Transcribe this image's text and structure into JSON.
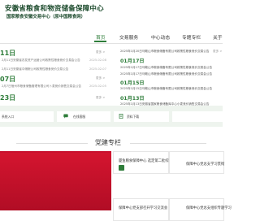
{
  "header": {
    "org_title": "安徽省粮食和物资储备保障中心",
    "org_subtitle": "国家粮食安徽交易中心（原中国粮食网）"
  },
  "nav": [
    "首页",
    "交易服务",
    "中心动态",
    "专题专栏",
    "关于"
  ],
  "left_news": [
    {
      "date": "11日",
      "more": "更多 >"
    },
    {
      "title": "2月11日安徽省农发资产运营公司政策性粮食竞价交易会公告",
      "date": "2025-02-08"
    },
    {
      "title": "2月11日安徽省中储粮公司政策性粮食竞价交易公告",
      "date": "2025-02-07"
    },
    {
      "date": "07日",
      "more": "更多 >"
    },
    {
      "title": "2月7日宿州市粮食储备管理有限公司卜麦竞价销售交易会公告",
      "date": "2025-02-05"
    },
    {
      "date": "23日",
      "more": "更多 >"
    }
  ],
  "right_news": [
    {
      "type": "item",
      "text": "2025年1月20日马鞍山市粮食储备有限公司政策性粮食竞价交易公告",
      "more": "更多 >"
    },
    {
      "type": "date",
      "text": "01月17日"
    },
    {
      "type": "item",
      "text": "2025年1月17日马鞍山市粮食储备有限公司政策性粮食竞价交易会公告"
    },
    {
      "type": "item",
      "text": "2025年1月17日马鞍山市粮食储备有限公司政策性粮食竞价交易会公告"
    },
    {
      "type": "date",
      "text": "01月15日"
    },
    {
      "type": "item",
      "text": "2025年1月15日马鞍山市粮食储备有限公司政策性粮食竞价交易会公告"
    },
    {
      "type": "date",
      "text": "01月13日"
    },
    {
      "type": "item",
      "text": "2025年1月13日安徽省国家粮食储备库中心小麦竞价销售交易会公告"
    }
  ],
  "portals": {
    "p1": "系统入口",
    "p2": "在线客服",
    "p3": "资料下载"
  },
  "party": {
    "title": "党建专栏",
    "cards": [
      "厦鱼粮食保障中心 选定第二批综合",
      "保障中心党总支学习贯彻",
      "保障中心党支部召开学习交流会",
      "保障中心党总支组织专题学习"
    ]
  },
  "colors": {
    "accent": "#2e7d3a",
    "banner": "#c8102e",
    "panel_bg": "#eef4ee"
  }
}
